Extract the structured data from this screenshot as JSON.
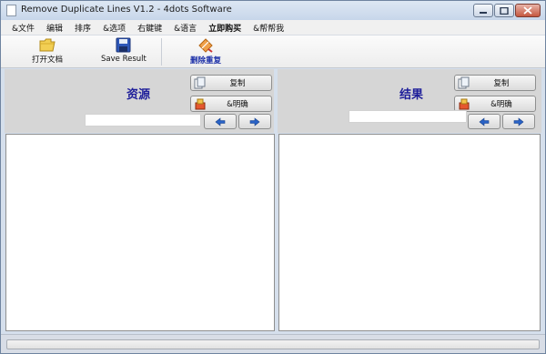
{
  "window": {
    "title": "Remove Duplicate Lines V1.2 - 4dots Software"
  },
  "menu": [
    {
      "label": "&文件",
      "bold": false
    },
    {
      "label": "编辑",
      "bold": false
    },
    {
      "label": "排序",
      "bold": false
    },
    {
      "label": "&选项",
      "bold": false
    },
    {
      "label": "右鍵键",
      "bold": false
    },
    {
      "label": "&语言",
      "bold": false
    },
    {
      "label": "立即购买",
      "bold": true
    },
    {
      "label": "&帮帮我",
      "bold": false
    }
  ],
  "toolbar": {
    "open_label": "打开文档",
    "save_label": "Save Result",
    "remove_label": "删除重复"
  },
  "left_pane": {
    "title": "资源",
    "copy_label": "复制",
    "clear_label": "&明确",
    "search_value": "",
    "text": ""
  },
  "right_pane": {
    "title": "结果",
    "copy_label": "复制",
    "clear_label": "&明确",
    "search_value": "",
    "text": ""
  },
  "status": {
    "progress": 0
  },
  "colors": {
    "pane_title": "#1e1e9a",
    "remove_label": "#1b2fa8"
  }
}
